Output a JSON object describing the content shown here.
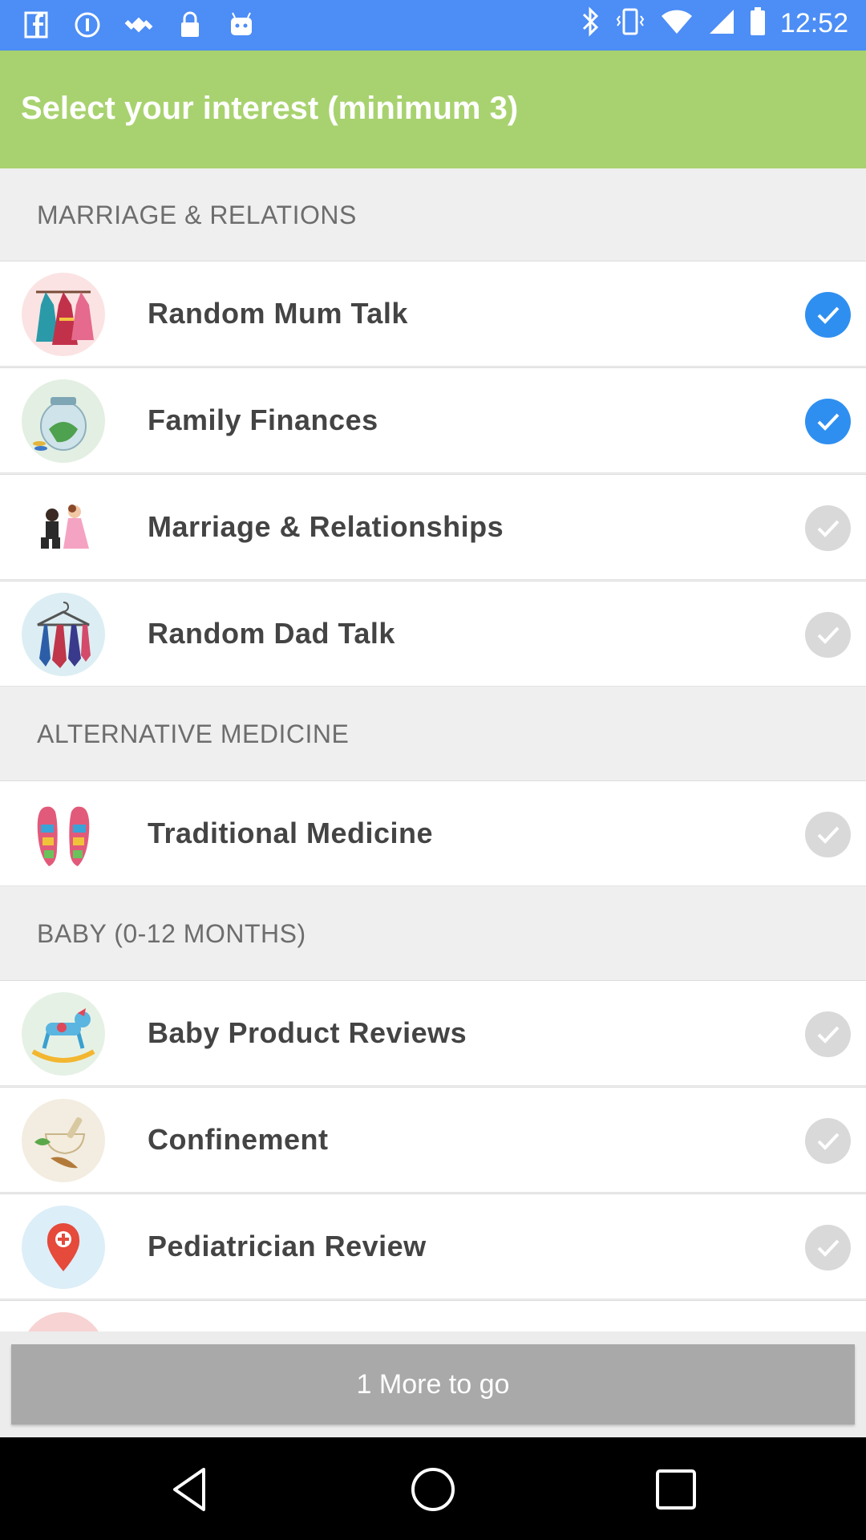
{
  "status_bar": {
    "time": "12:52",
    "left_icons": [
      "facebook-icon",
      "circle-info-icon",
      "fake-gps-icon",
      "lock-icon",
      "android-icon"
    ],
    "right_icons": [
      "bluetooth-icon",
      "vibrate-icon",
      "wifi-icon",
      "signal-icon",
      "battery-icon"
    ]
  },
  "header": {
    "title": "Select your interest (minimum 3)"
  },
  "sections": [
    {
      "title": "MARRIAGE & RELATIONS",
      "items": [
        {
          "label": "Random Mum Talk",
          "checked": true,
          "icon": "dresses-icon"
        },
        {
          "label": "Family Finances",
          "checked": true,
          "icon": "money-jar-icon"
        },
        {
          "label": "Marriage & Relationships",
          "checked": false,
          "icon": "couple-icon"
        },
        {
          "label": "Random Dad Talk",
          "checked": false,
          "icon": "ties-icon"
        }
      ]
    },
    {
      "title": "ALTERNATIVE MEDICINE",
      "items": [
        {
          "label": "Traditional Medicine",
          "checked": false,
          "icon": "reflexology-feet-icon"
        }
      ]
    },
    {
      "title": "BABY (0-12 MONTHS)",
      "items": [
        {
          "label": "Baby Product Reviews",
          "checked": false,
          "icon": "rocking-horse-icon"
        },
        {
          "label": "Confinement",
          "checked": false,
          "icon": "herbal-bowl-icon"
        },
        {
          "label": "Pediatrician Review",
          "checked": false,
          "icon": "map-pin-icon"
        }
      ]
    }
  ],
  "footer": {
    "button_label": "1 More to go"
  },
  "colors": {
    "status_bar": "#4c8df6",
    "header": "#a8d26f",
    "check_on": "#2f8ff0",
    "check_off": "#d9d9d9",
    "button": "#a9a9a9"
  }
}
